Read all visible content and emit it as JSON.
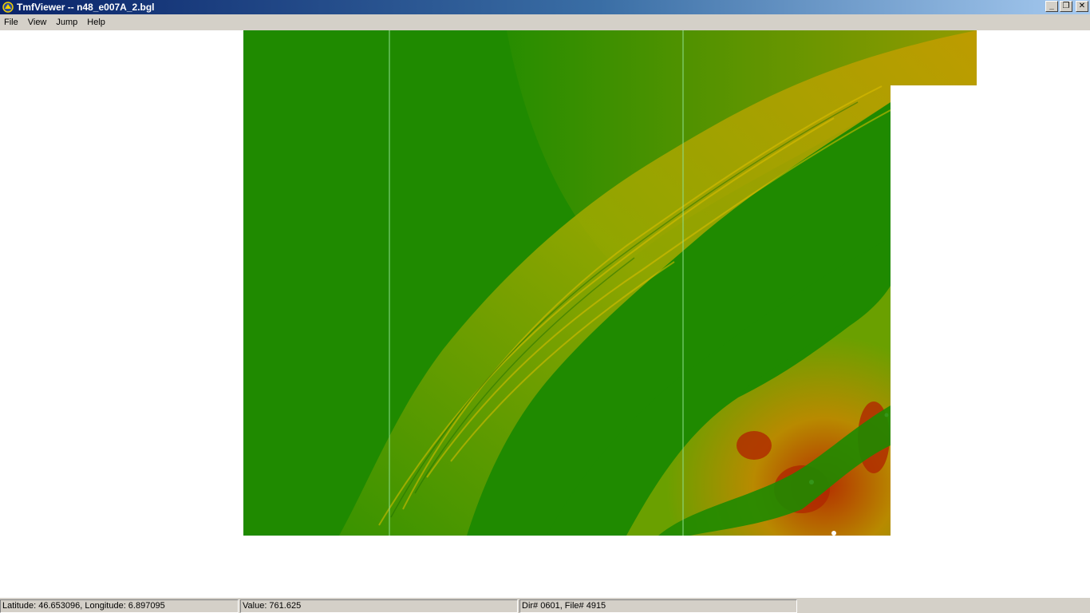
{
  "window": {
    "title": "TmfViewer -- n48_e007A_2.bgl",
    "app_icon": "tmfviewer-icon",
    "controls": {
      "minimize": "_",
      "restore": "❐",
      "close": "✕"
    }
  },
  "menu": {
    "items": [
      {
        "label": "File"
      },
      {
        "label": "View"
      },
      {
        "label": "Jump"
      },
      {
        "label": "Help"
      }
    ]
  },
  "map": {
    "colors": {
      "lowland": "#1f8a00",
      "hills": "#8fa600",
      "ridges": "#c9a400",
      "mountains": "#b03000",
      "peaks": "#ffffff",
      "tile_border": "#8fe08f",
      "background": "#ffffff"
    }
  },
  "status": {
    "coords": "Latitude: 46.653096, Longitude: 6.897095",
    "value": "Value: 761.625",
    "file": "Dir# 0601, File# 4915"
  }
}
